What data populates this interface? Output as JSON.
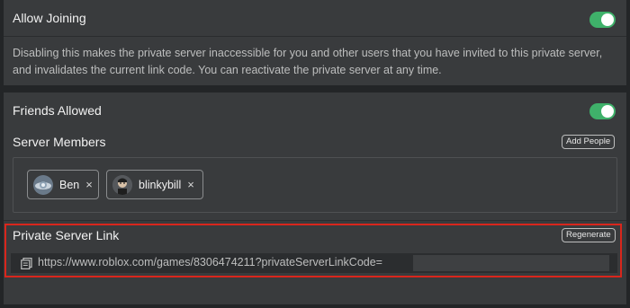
{
  "allow_joining": {
    "title": "Allow Joining",
    "enabled": true,
    "description": "Disabling this makes the private server inaccessible for you and other users that you have invited to this private server, and invalidates the current link code. You can reactivate the private server at any time."
  },
  "friends_allowed": {
    "title": "Friends Allowed",
    "enabled": true
  },
  "server_members": {
    "title": "Server Members",
    "add_button_label": "Add People",
    "members": [
      {
        "name": "Ben",
        "remove_label": "×"
      },
      {
        "name": "blinkybill",
        "remove_label": "×"
      }
    ]
  },
  "private_server_link": {
    "title": "Private Server Link",
    "regenerate_label": "Regenerate",
    "url": "https://www.roblox.com/games/8306474211?privateServerLinkCode="
  },
  "colors": {
    "toggle_on": "#3fb16a",
    "highlight": "#d9261c"
  }
}
